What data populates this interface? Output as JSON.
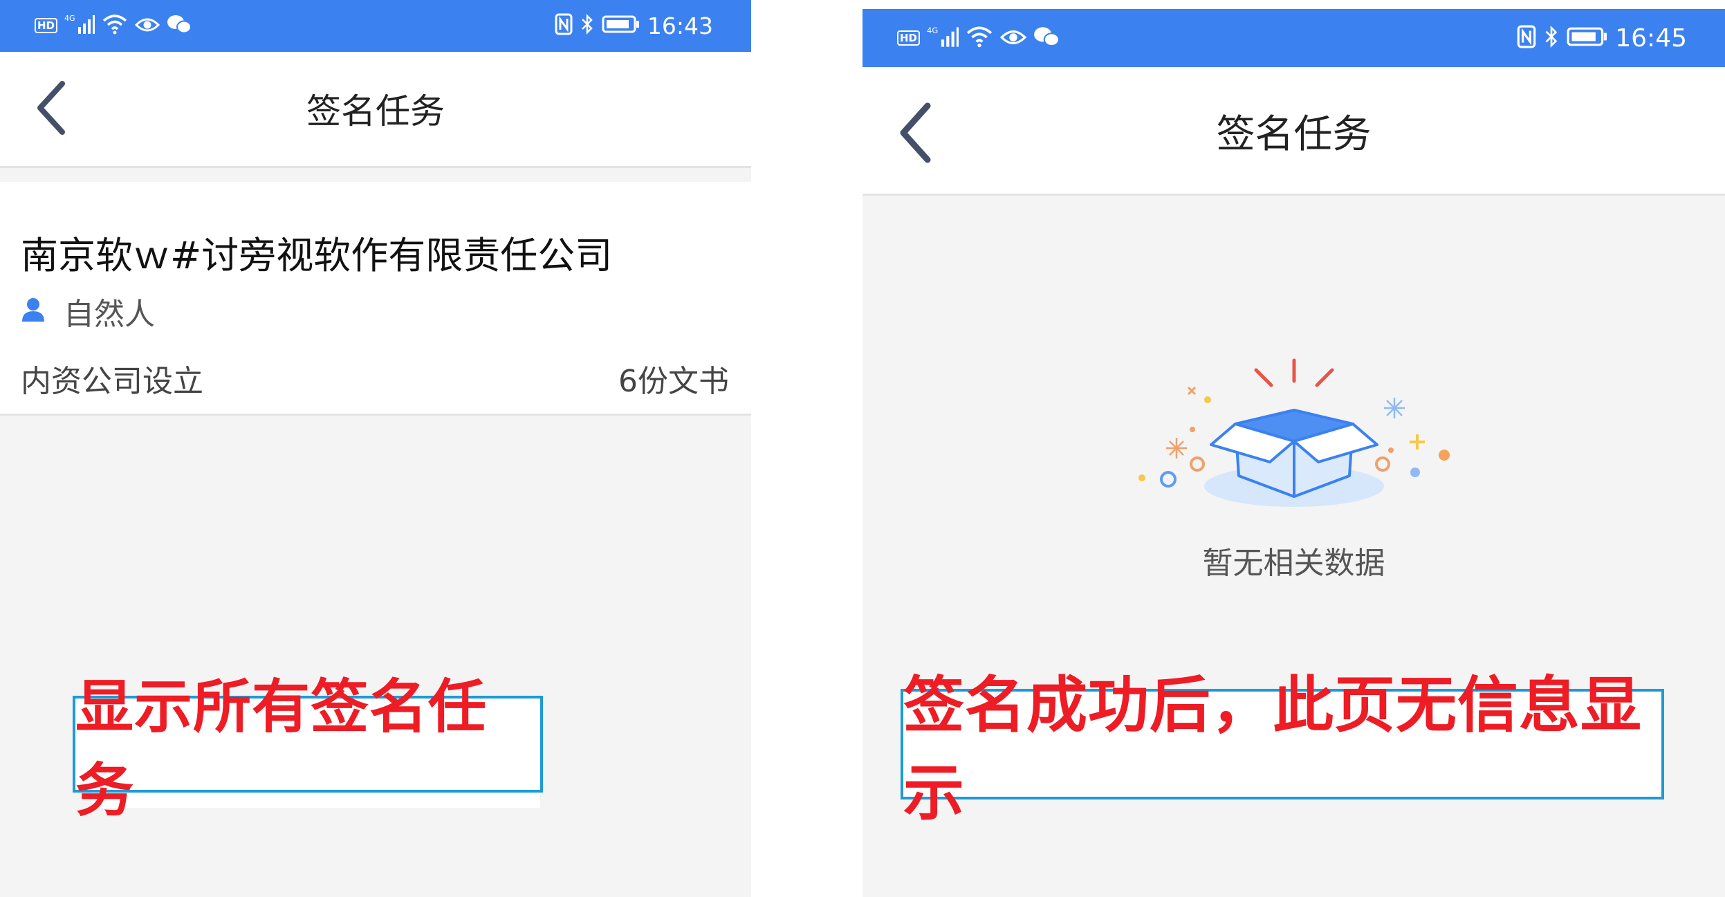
{
  "left_screen": {
    "status_bar": {
      "time": "16:43",
      "hd": "HD",
      "net": "4G"
    },
    "nav": {
      "title": "签名任务"
    },
    "task": {
      "company": "南京软ｗ#讨旁视软作有限责任公司",
      "signer_type": "自然人",
      "business_type": "内资公司设立",
      "doc_count": "6份文书"
    },
    "annotation": "显示所有签名任务"
  },
  "right_screen": {
    "status_bar": {
      "time": "16:45",
      "hd": "HD",
      "net": "4G"
    },
    "nav": {
      "title": "签名任务"
    },
    "empty_text": "暂无相关数据",
    "annotation": "签名成功后，此页无信息显示"
  },
  "colors": {
    "status_bar": "#3b82f0",
    "annotation_text": "#ee1c24",
    "annotation_border": "#1e9ad6",
    "accent": "#3b82f0"
  }
}
